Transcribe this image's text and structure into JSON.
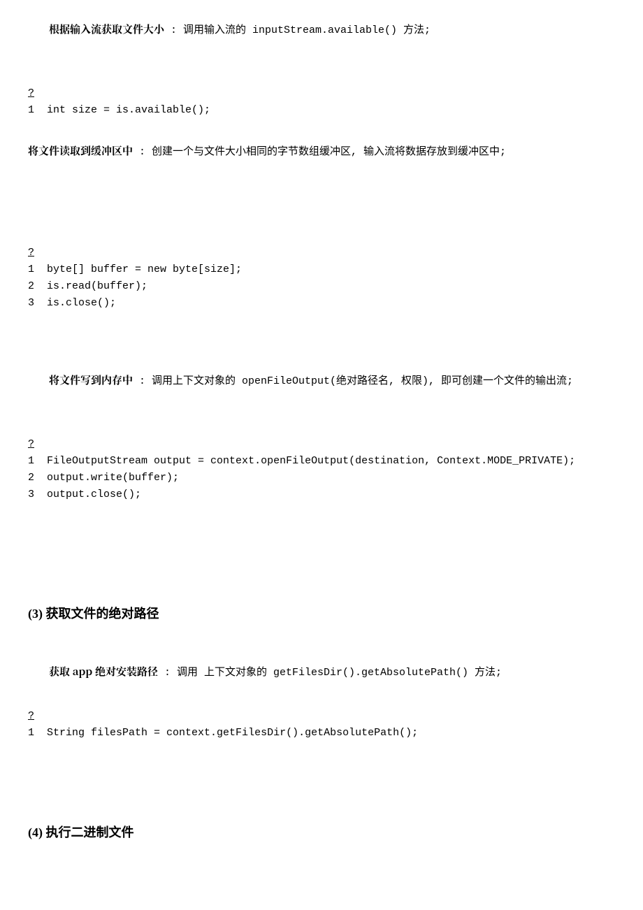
{
  "p1": {
    "bold": "根据输入流获取文件大小",
    "rest": "  :  调用输入流的 inputStream.available() 方法;"
  },
  "code1": {
    "q": "?",
    "lines": [
      {
        "n": "1",
        "c": "int size = is.available();"
      }
    ]
  },
  "p2": {
    "bold": "将文件读取到缓冲区中",
    "rest": "  :  创建一个与文件大小相同的字节数组缓冲区, 输入流将数据存放到缓冲区中;"
  },
  "code2": {
    "q": "?",
    "lines": [
      {
        "n": "1",
        "c": "byte[] buffer = new byte[size];"
      },
      {
        "n": "2",
        "c": "is.read(buffer);"
      },
      {
        "n": "3",
        "c": "is.close();"
      }
    ]
  },
  "p3": {
    "bold": "将文件写到内存中",
    "rest": "  :  调用上下文对象的 openFileOutput(绝对路径名, 权限), 即可创建一个文件的输出流;"
  },
  "code3": {
    "q": "?",
    "lines": [
      {
        "n": "1",
        "c": "FileOutputStream output = context.openFileOutput(destination, Context.MODE_PRIVATE);"
      },
      {
        "n": "2",
        "c": "output.write(buffer);"
      },
      {
        "n": "3",
        "c": "output.close();"
      }
    ]
  },
  "h1": "(3) 获取文件的绝对路径",
  "p4": {
    "bold": "获取 app 绝对安装路径",
    "rest": "  :  调用 上下文对象的 getFilesDir().getAbsolutePath() 方法;"
  },
  "code4": {
    "q": "?",
    "lines": [
      {
        "n": "1",
        "c": "String filesPath = context.getFilesDir().getAbsolutePath();"
      }
    ]
  },
  "h2": "(4) 执行二进制文件"
}
